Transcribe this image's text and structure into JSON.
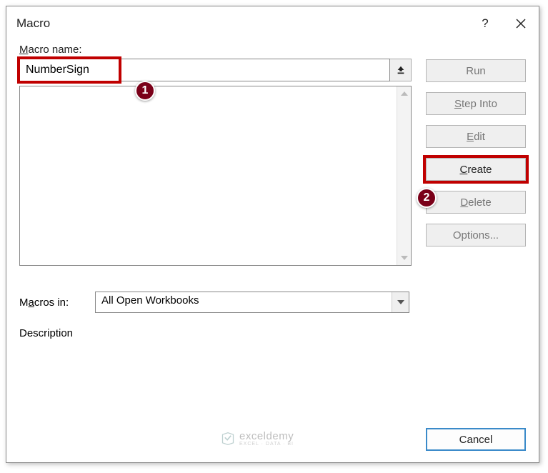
{
  "dialog": {
    "title": "Macro",
    "help_char": "?",
    "name_label": "Macro name:",
    "name_value": "NumberSign",
    "macros_in_label": "Macros in:",
    "macros_in_value": "All Open Workbooks",
    "description_label": "Description"
  },
  "buttons": {
    "run": "Run",
    "step_into": "Step Into",
    "edit": "Edit",
    "create": "Create",
    "delete": "Delete",
    "options": "Options...",
    "cancel": "Cancel"
  },
  "callouts": {
    "one": "1",
    "two": "2"
  },
  "watermark": {
    "main": "exceldemy",
    "sub": "EXCEL · DATA · BI"
  }
}
